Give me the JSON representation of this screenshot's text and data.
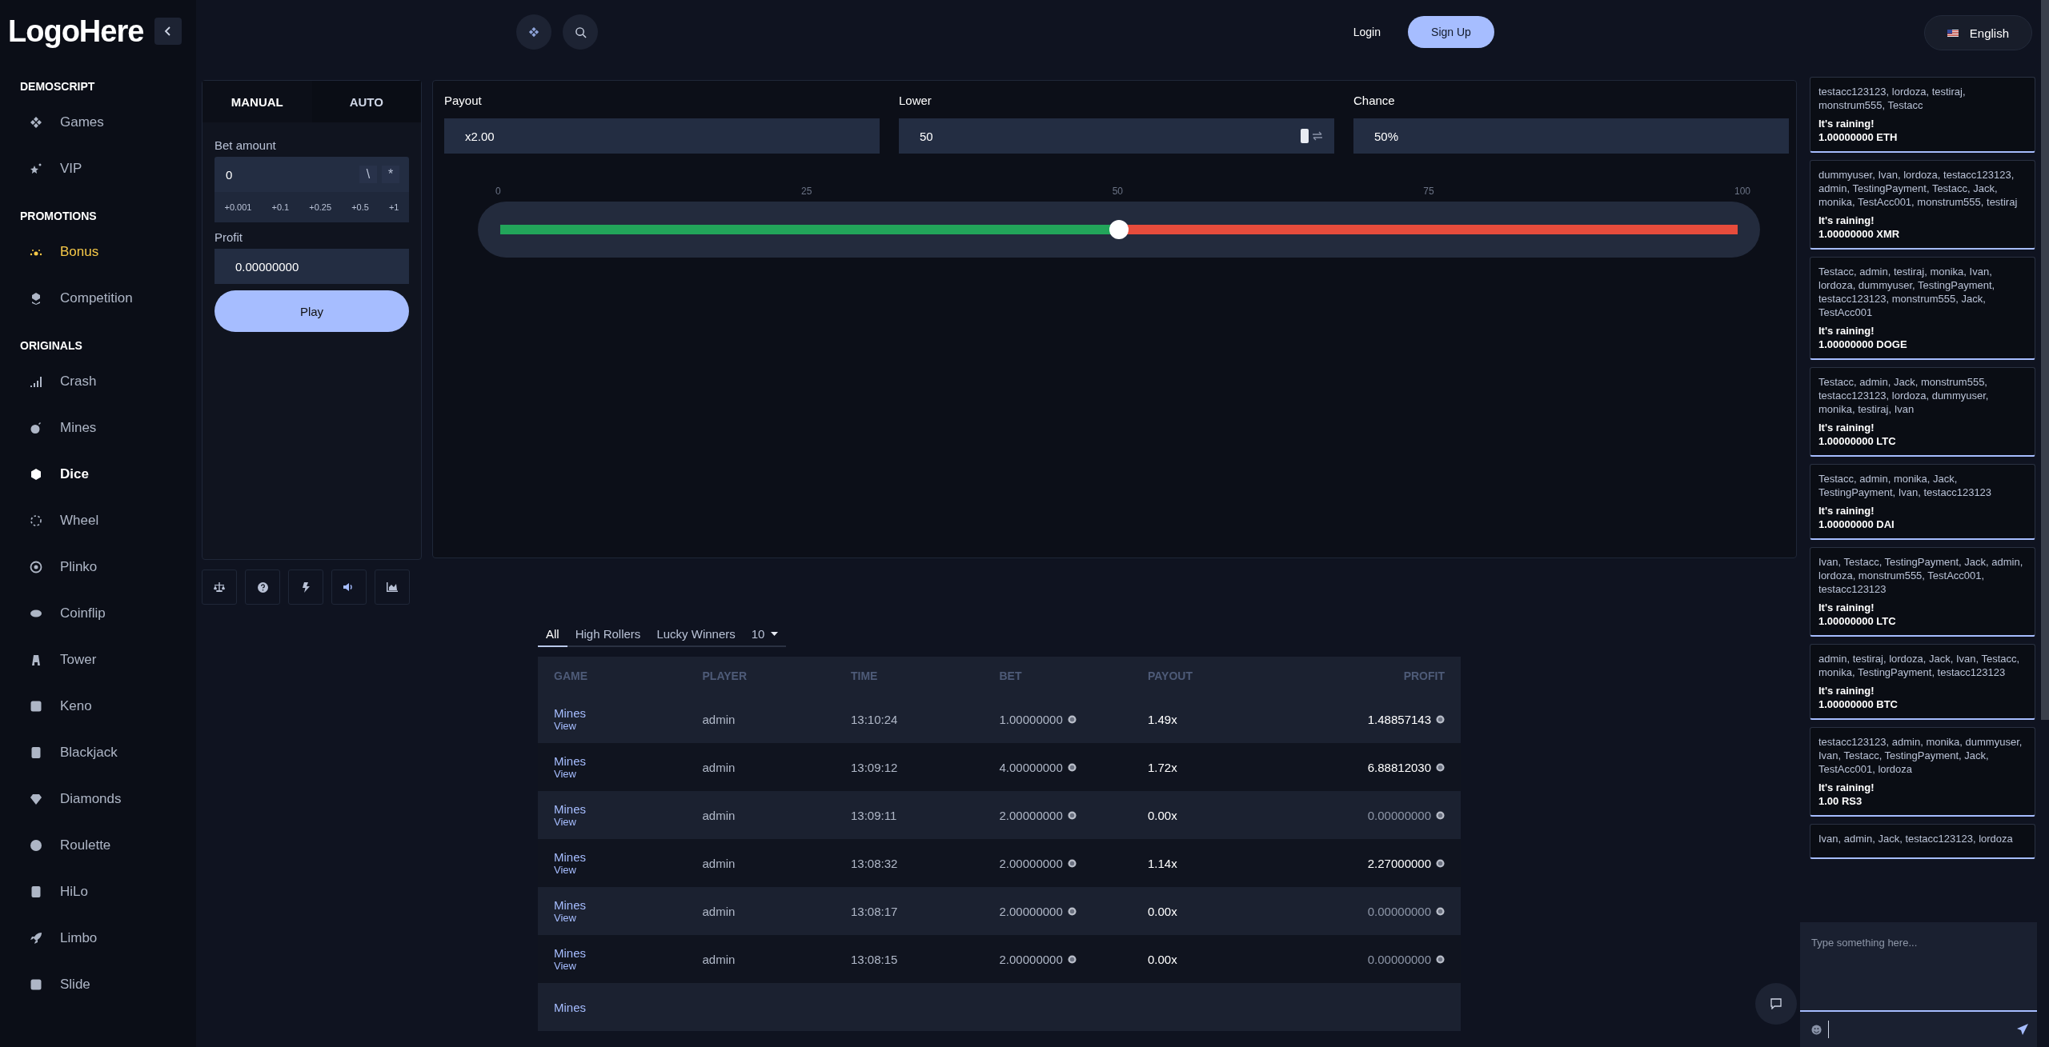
{
  "logo": "LogoHere",
  "sidebar": {
    "sections": [
      {
        "title": "DEMOSCRIPT",
        "items": [
          {
            "label": "Games",
            "selected": false,
            "highlighted": false
          },
          {
            "label": "VIP",
            "selected": false,
            "highlighted": false
          }
        ]
      },
      {
        "title": "PROMOTIONS",
        "items": [
          {
            "label": "Bonus",
            "selected": false,
            "highlighted": true
          },
          {
            "label": "Competition",
            "selected": false,
            "highlighted": false
          }
        ]
      },
      {
        "title": "ORIGINALS",
        "items": [
          {
            "label": "Crash",
            "selected": false,
            "highlighted": false
          },
          {
            "label": "Mines",
            "selected": false,
            "highlighted": false
          },
          {
            "label": "Dice",
            "selected": true,
            "highlighted": false
          },
          {
            "label": "Wheel",
            "selected": false,
            "highlighted": false
          },
          {
            "label": "Plinko",
            "selected": false,
            "highlighted": false
          },
          {
            "label": "Coinflip",
            "selected": false,
            "highlighted": false
          },
          {
            "label": "Tower",
            "selected": false,
            "highlighted": false
          },
          {
            "label": "Keno",
            "selected": false,
            "highlighted": false
          },
          {
            "label": "Blackjack",
            "selected": false,
            "highlighted": false
          },
          {
            "label": "Diamonds",
            "selected": false,
            "highlighted": false
          },
          {
            "label": "Roulette",
            "selected": false,
            "highlighted": false
          },
          {
            "label": "HiLo",
            "selected": false,
            "highlighted": false
          },
          {
            "label": "Limbo",
            "selected": false,
            "highlighted": false
          },
          {
            "label": "Slide",
            "selected": false,
            "highlighted": false
          }
        ]
      }
    ]
  },
  "top_bar": {
    "login": "Login",
    "signup": "Sign Up",
    "language": "English"
  },
  "bet_panel": {
    "tabs": [
      {
        "label": "MANUAL",
        "selected": true
      },
      {
        "label": "AUTO",
        "selected": false
      }
    ],
    "bet_label": "Bet amount",
    "bet_value": "0",
    "half_button": "\\",
    "double_button": "*",
    "quick_adds": [
      "+0.001",
      "+0.1",
      "+0.25",
      "+0.5",
      "+1"
    ],
    "profit_label": "Profit",
    "profit_value": "0.00000000",
    "play": "Play"
  },
  "game": {
    "fields": [
      {
        "label": "Payout",
        "value": "x2.00",
        "kind": "plain"
      },
      {
        "label": "Lower",
        "value": "50",
        "kind": "swap"
      },
      {
        "label": "Chance",
        "value": "50%",
        "kind": "plain"
      }
    ],
    "slider": {
      "ticks": [
        "0",
        "25",
        "50",
        "75",
        "100"
      ],
      "level": 0.5
    }
  },
  "bets": {
    "tabs": [
      {
        "label": "All",
        "selected": true
      },
      {
        "label": "High Rollers",
        "selected": false
      },
      {
        "label": "Lucky Winners",
        "selected": false
      }
    ],
    "page_size": "10",
    "columns": [
      "GAME",
      "PLAYER",
      "TIME",
      "BET",
      "PAYOUT",
      "PROFIT"
    ],
    "rows": [
      {
        "game": "Mines",
        "link": "View",
        "player": "admin",
        "time": "13:10:24",
        "bet": "1.00000000",
        "payout": "1.49x",
        "profit": "1.48857143",
        "won": true
      },
      {
        "game": "Mines",
        "link": "View",
        "player": "admin",
        "time": "13:09:12",
        "bet": "4.00000000",
        "payout": "1.72x",
        "profit": "6.88812030",
        "won": true
      },
      {
        "game": "Mines",
        "link": "View",
        "player": "admin",
        "time": "13:09:11",
        "bet": "2.00000000",
        "payout": "0.00x",
        "profit": "0.00000000",
        "won": false
      },
      {
        "game": "Mines",
        "link": "View",
        "player": "admin",
        "time": "13:08:32",
        "bet": "2.00000000",
        "payout": "1.14x",
        "profit": "2.27000000",
        "won": true
      },
      {
        "game": "Mines",
        "link": "View",
        "player": "admin",
        "time": "13:08:17",
        "bet": "2.00000000",
        "payout": "0.00x",
        "profit": "0.00000000",
        "won": false
      },
      {
        "game": "Mines",
        "link": "View",
        "player": "admin",
        "time": "13:08:15",
        "bet": "2.00000000",
        "payout": "0.00x",
        "profit": "0.00000000",
        "won": false
      },
      {
        "game": "Mines"
      }
    ]
  },
  "chat": {
    "messages": [
      {
        "users": "testacc123123, lordoza, testiraj, monstrum555, Testacc",
        "title": "It's raining!",
        "amount": "1.00000000 ETH"
      },
      {
        "users": "dummyuser, Ivan, lordoza, testacc123123, admin, TestingPayment, Testacc, Jack, monika, TestAcc001, monstrum555, testiraj",
        "title": "It's raining!",
        "amount": "1.00000000 XMR"
      },
      {
        "users": "Testacc, admin, testiraj, monika, Ivan, lordoza, dummyuser, TestingPayment, testacc123123, monstrum555, Jack, TestAcc001",
        "title": "It's raining!",
        "amount": "1.00000000 DOGE"
      },
      {
        "users": "Testacc, admin, Jack, monstrum555, testacc123123, lordoza, dummyuser, monika, testiraj, Ivan",
        "title": "It's raining!",
        "amount": "1.00000000 LTC"
      },
      {
        "users": "Testacc, admin, monika, Jack, TestingPayment, Ivan, testacc123123",
        "title": "It's raining!",
        "amount": "1.00000000 DAI"
      },
      {
        "users": "Ivan, Testacc, TestingPayment, Jack, admin, lordoza, monstrum555, TestAcc001, testacc123123",
        "title": "It's raining!",
        "amount": "1.00000000 LTC"
      },
      {
        "users": "admin, testiraj, lordoza, Jack, Ivan, Testacc, monika, TestingPayment, testacc123123",
        "title": "It's raining!",
        "amount": "1.00000000 BTC"
      },
      {
        "users": "testacc123123, admin, monika, dummyuser, Ivan, Testacc, TestingPayment, Jack, TestAcc001, lordoza",
        "title": "It's raining!",
        "amount": "1.00 RS3"
      },
      {
        "users": "Ivan, admin, Jack, testacc123123, lordoza"
      }
    ],
    "placeholder": "Type something here..."
  }
}
